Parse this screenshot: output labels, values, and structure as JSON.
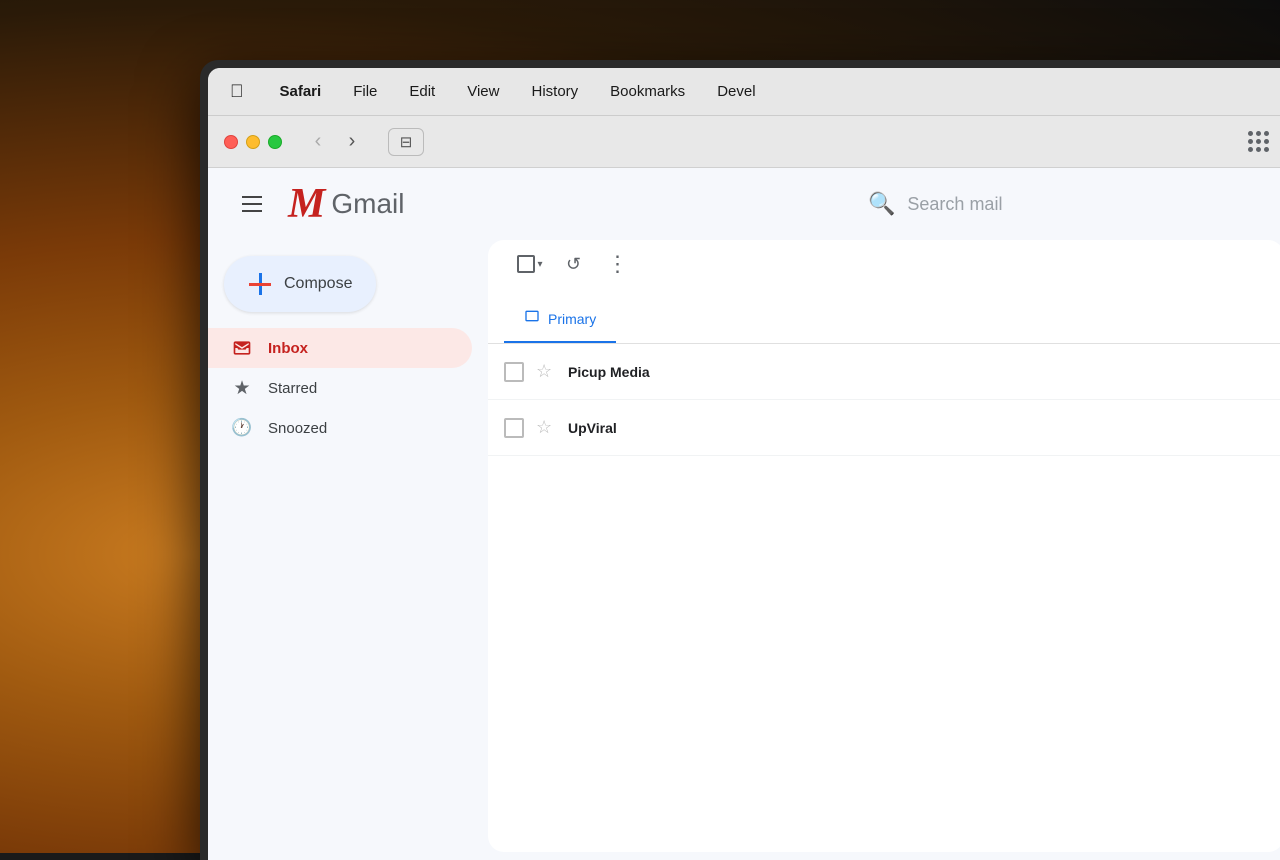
{
  "background": {
    "color": "#1a1a1a"
  },
  "menubar": {
    "apple": "🍎",
    "items": [
      {
        "id": "safari",
        "label": "Safari",
        "bold": true
      },
      {
        "id": "file",
        "label": "File",
        "bold": false
      },
      {
        "id": "edit",
        "label": "Edit",
        "bold": false
      },
      {
        "id": "view",
        "label": "View",
        "bold": false
      },
      {
        "id": "history",
        "label": "History",
        "bold": false
      },
      {
        "id": "bookmarks",
        "label": "Bookmarks",
        "bold": false
      },
      {
        "id": "develop",
        "label": "Devel",
        "bold": false
      }
    ]
  },
  "window": {
    "nav": {
      "back_label": "‹",
      "forward_label": "›",
      "sidebar_label": "⊟"
    }
  },
  "gmail": {
    "logo_m": "M",
    "logo_text": "Gmail",
    "search_placeholder": "Search mail",
    "compose_label": "Compose",
    "nav_items": [
      {
        "id": "inbox",
        "label": "Inbox",
        "icon": "inbox",
        "active": true
      },
      {
        "id": "starred",
        "label": "Starred",
        "icon": "star",
        "active": false
      },
      {
        "id": "snoozed",
        "label": "Snoozed",
        "icon": "clock",
        "active": false
      }
    ],
    "tabs": [
      {
        "id": "primary",
        "label": "Primary",
        "icon": "inbox",
        "active": true
      }
    ],
    "emails": [
      {
        "sender": "Picup Media",
        "star": false
      },
      {
        "sender": "UpViral",
        "star": false
      }
    ]
  }
}
